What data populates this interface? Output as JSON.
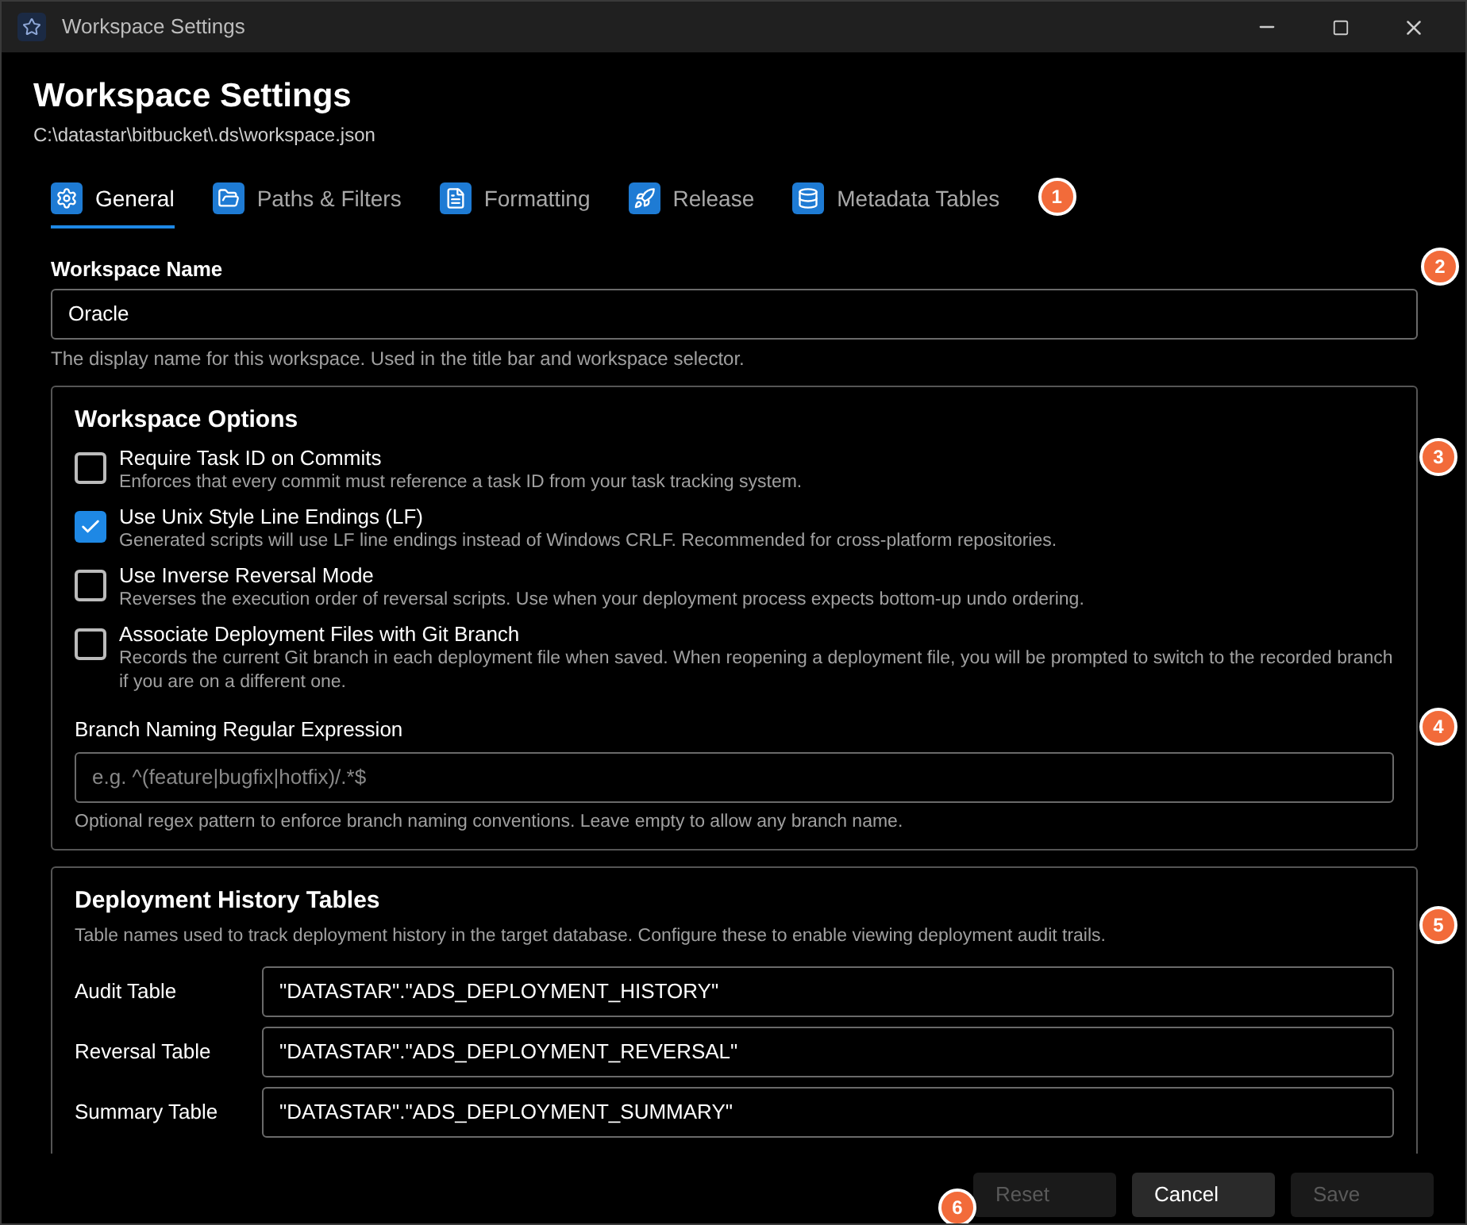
{
  "window": {
    "title": "Workspace Settings"
  },
  "header": {
    "title": "Workspace Settings",
    "path": "C:\\datastar\\bitbucket\\.ds\\workspace.json"
  },
  "tabs": [
    {
      "label": "General",
      "selected": true,
      "kind": "gear"
    },
    {
      "label": "Paths & Filters",
      "selected": false,
      "kind": "folder"
    },
    {
      "label": "Formatting",
      "selected": false,
      "kind": "document"
    },
    {
      "label": "Release",
      "selected": false,
      "kind": "rocket"
    },
    {
      "label": "Metadata Tables",
      "selected": false,
      "kind": "database"
    }
  ],
  "workspace_name": {
    "label": "Workspace Name",
    "value": "Oracle",
    "help": "The display name for this workspace. Used in the title bar and workspace selector."
  },
  "options": {
    "title": "Workspace Options",
    "items": [
      {
        "label": "Require Task ID on Commits",
        "description": "Enforces that every commit must reference a task ID from your task tracking system.",
        "checked": false
      },
      {
        "label": "Use Unix Style Line Endings (LF)",
        "description": "Generated scripts will use LF line endings instead of Windows CRLF. Recommended for cross-platform repositories.",
        "checked": true
      },
      {
        "label": "Use Inverse Reversal Mode",
        "description": "Reverses the execution order of reversal scripts. Use when your deployment process expects bottom-up undo ordering.",
        "checked": false
      },
      {
        "label": "Associate Deployment Files with Git Branch",
        "description": "Records the current Git branch in each deployment file when saved. When reopening a deployment file, you will be prompted to switch to the recorded branch if you are on a different one.",
        "checked": false
      }
    ],
    "regex": {
      "label": "Branch Naming Regular Expression",
      "placeholder": "e.g. ^(feature|bugfix|hotfix)/.*$",
      "help": "Optional regex pattern to enforce branch naming conventions. Leave empty to allow any branch name."
    }
  },
  "history": {
    "title": "Deployment History Tables",
    "description": "Table names used to track deployment history in the target database. Configure these to enable viewing deployment audit trails.",
    "rows": [
      {
        "label": "Audit Table",
        "value": "\"DATASTAR\".\"ADS_DEPLOYMENT_HISTORY\""
      },
      {
        "label": "Reversal Table",
        "value": "\"DATASTAR\".\"ADS_DEPLOYMENT_REVERSAL\""
      },
      {
        "label": "Summary Table",
        "value": "\"DATASTAR\".\"ADS_DEPLOYMENT_SUMMARY\""
      }
    ]
  },
  "buttons": [
    {
      "label": "Reset",
      "disabled": true
    },
    {
      "label": "Cancel",
      "disabled": false
    },
    {
      "label": "Save",
      "disabled": true
    }
  ],
  "callouts": [
    "1",
    "2",
    "3",
    "4",
    "5",
    "6"
  ]
}
